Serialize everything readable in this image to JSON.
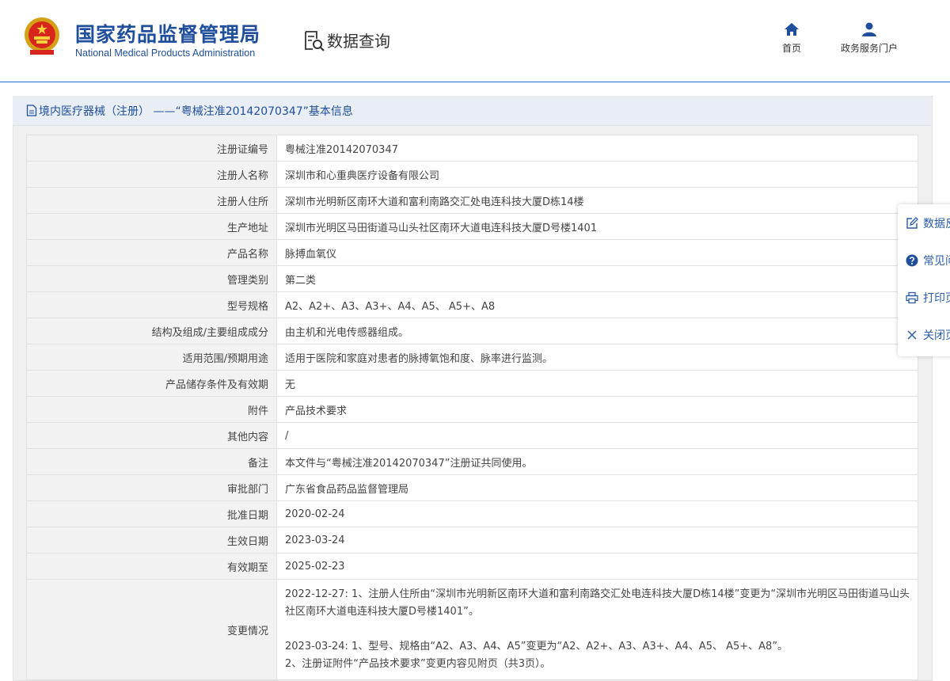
{
  "header": {
    "org_name_cn": "国家药品监督管理局",
    "org_name_en": "National Medical Products Administration",
    "section_title": "数据查询",
    "nav": [
      {
        "label": "首页",
        "icon": "home-icon"
      },
      {
        "label": "政务服务门户",
        "icon": "user-icon"
      }
    ]
  },
  "panel": {
    "title": "境内医疗器械（注册） ——“粤械注准20142070347”基本信息"
  },
  "rows": [
    {
      "key": "注册证编号",
      "value": "粤械注准20142070347"
    },
    {
      "key": "注册人名称",
      "value": "深圳市和心重典医疗设备有限公司"
    },
    {
      "key": "注册人住所",
      "value": "深圳市光明新区南环大道和富利南路交汇处电连科技大厦D栋14楼"
    },
    {
      "key": "生产地址",
      "value": "深圳市光明区马田街道马山头社区南环大道电连科技大厦D号楼1401"
    },
    {
      "key": "产品名称",
      "value": "脉搏血氧仪"
    },
    {
      "key": "管理类别",
      "value": "第二类"
    },
    {
      "key": "型号规格",
      "value": "A2、A2+、A3、A3+、A4、A5、 A5+、A8"
    },
    {
      "key": "结构及组成/主要组成成分",
      "value": "由主机和光电传感器组成。"
    },
    {
      "key": "适用范围/预期用途",
      "value": "适用于医院和家庭对患者的脉搏氧饱和度、脉率进行监测。"
    },
    {
      "key": "产品储存条件及有效期",
      "value": "无"
    },
    {
      "key": "附件",
      "value": "产品技术要求"
    },
    {
      "key": "其他内容",
      "value": "/"
    },
    {
      "key": "备注",
      "value": "本文件与“粤械注准20142070347”注册证共同使用。"
    },
    {
      "key": "审批部门",
      "value": "广东省食品药品监督管理局"
    },
    {
      "key": "批准日期",
      "value": "2020-02-24"
    },
    {
      "key": "生效日期",
      "value": "2023-03-24"
    },
    {
      "key": "有效期至",
      "value": "2025-02-23"
    }
  ],
  "change": {
    "key": "变更情况",
    "line1": "2022-12-27: 1、注册人住所由“深圳市光明新区南环大道和富利南路交汇处电连科技大厦D栋14楼”变更为“深圳市光明区马田街道马山头社区南环大道电连科技大厦D号楼1401”。",
    "line2": "2023-03-24: 1、型号、规格由“A2、A3、A4、A5”变更为“A2、A2+、A3、A3+、A4、A5、 A5+、A8”。",
    "line3": "2、注册证附件“产品技术要求”变更内容见附页（共3页）。"
  },
  "float_bar": [
    {
      "label": "数据反馈",
      "icon": "edit-icon"
    },
    {
      "label": "常见问题",
      "icon": "help-icon"
    },
    {
      "label": "打印页面",
      "icon": "print-icon"
    },
    {
      "label": "关闭页面",
      "icon": "close-icon"
    }
  ],
  "colors": {
    "brand_blue": "#1f4f9c",
    "title_bg": "#e9eef4",
    "key_bg": "#f2f2f2"
  }
}
